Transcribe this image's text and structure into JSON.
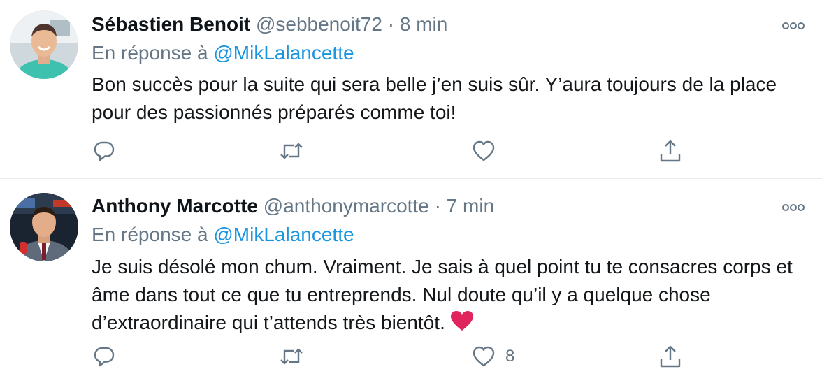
{
  "tweets": [
    {
      "name": "Sébastien Benoit",
      "handle": "@sebbenoit72",
      "separator": "·",
      "time": "8 min",
      "reply_prefix": "En réponse à",
      "reply_mention": "@MikLalancette",
      "text": "Bon succès pour la suite qui sera belle j’en suis sûr. Y’aura toujours de la place pour des passionnés préparés comme toi!",
      "like_count": ""
    },
    {
      "name": "Anthony Marcotte",
      "handle": "@anthonymarcotte",
      "separator": "·",
      "time": "7 min",
      "reply_prefix": "En réponse à",
      "reply_mention": "@MikLalancette",
      "text": "Je suis désolé mon chum. Vraiment. Je sais à quel point tu te consacres corps et âme dans tout ce que tu entreprends. Nul doute qu’il y a quelque chose d’extraordinaire qui t’attends très bientôt.",
      "like_count": "8"
    }
  ],
  "icons": {
    "more": "more-options-icon",
    "reply": "reply-icon",
    "retweet": "retweet-icon",
    "like": "heart-outline-icon",
    "share": "share-icon",
    "emoji": "red-heart-emoji"
  },
  "colors": {
    "name": "#0f1419",
    "meta": "#657786",
    "mention": "#1b95e0",
    "divider": "#e6ecf0",
    "emoji_heart": "#e0245e"
  }
}
